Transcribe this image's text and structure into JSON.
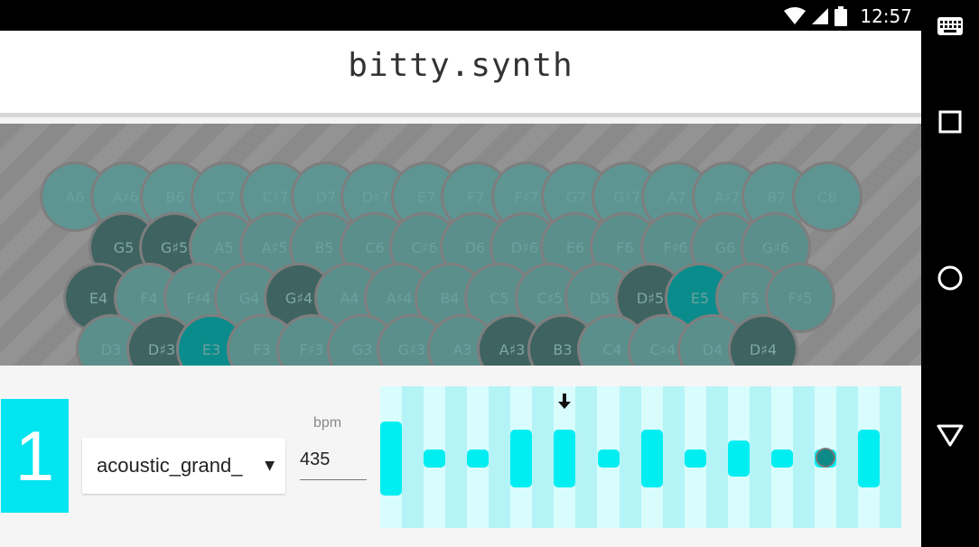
{
  "status_bar": {
    "time": "12:57",
    "icons": [
      "wifi-icon",
      "signal-icon",
      "battery-icon"
    ]
  },
  "nav_bar": {
    "icons": [
      "keyboard-icon",
      "recents-icon",
      "home-icon",
      "back-icon"
    ]
  },
  "header": {
    "title": "bitty.synth"
  },
  "keyboard": {
    "rows": [
      {
        "row": "top",
        "keys": [
          "A6",
          "A♯6",
          "B6",
          "C7",
          "C♯7",
          "D7",
          "D♯7",
          "E7",
          "F7",
          "F♯7",
          "G7",
          "G♯7",
          "A7",
          "A♯7",
          "B7",
          "C8"
        ]
      },
      {
        "row": "second",
        "keys": [
          "G5",
          "G♯5",
          "A5",
          "A♯5",
          "B5",
          "C6",
          "C♯6",
          "D6",
          "D♯6",
          "E6",
          "F6",
          "F♯6",
          "G6",
          "G♯6"
        ],
        "dim": [
          "G5",
          "G♯5"
        ]
      },
      {
        "row": "third",
        "keys": [
          "E4",
          "F4",
          "F♯4",
          "G4",
          "G♯4",
          "A4",
          "A♯4",
          "B4",
          "C5",
          "C♯5",
          "D5",
          "D♯5",
          "E5",
          "F5",
          "F♯5"
        ],
        "dim": [
          "E4",
          "G♯4",
          "D♯5"
        ],
        "active": [
          "E5"
        ]
      },
      {
        "row": "bottom",
        "keys": [
          "D3",
          "D♯3",
          "E3",
          "F3",
          "F♯3",
          "G3",
          "G♯3",
          "A3",
          "A♯3",
          "B3",
          "C4",
          "C♯4",
          "D4",
          "D♯4"
        ],
        "dim": [
          "D♯3",
          "A♯3",
          "B3",
          "D♯4"
        ],
        "active": [
          "E3"
        ]
      }
    ]
  },
  "controls": {
    "track_number": "1",
    "instrument": "acoustic_grand_",
    "bpm_label": "bpm",
    "bpm_value": "435"
  },
  "sequencer": {
    "steps": [
      {
        "level": "high"
      },
      {
        "level": "low"
      },
      {
        "level": "low"
      },
      {
        "level": "high"
      },
      {
        "level": "high"
      },
      {
        "level": "low"
      },
      {
        "level": "high"
      },
      {
        "level": "low"
      },
      {
        "level": "mid"
      },
      {
        "level": "low"
      },
      {
        "level": "low"
      },
      {
        "level": "high"
      }
    ],
    "playhead_step": 4,
    "cursor_step": 10
  },
  "colors": {
    "accent": "#00e5f0",
    "key": "#5b8f8c",
    "key_active": "#0b8c8c",
    "sequencer_bg": "#d9fcfc",
    "sequencer_step": "#00eef2"
  }
}
